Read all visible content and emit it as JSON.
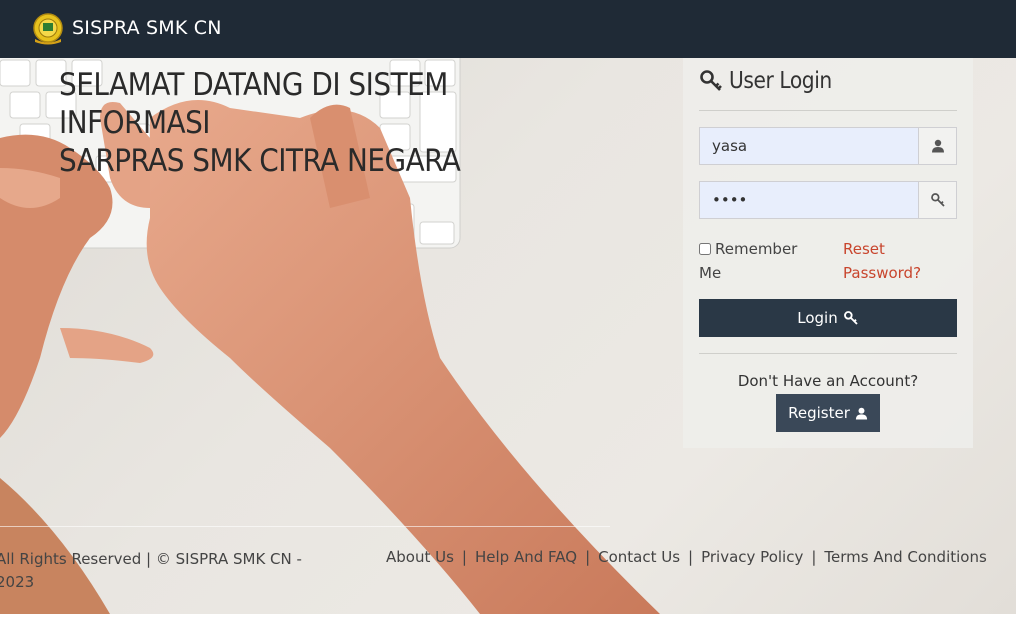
{
  "header": {
    "brand": "SISPRA SMK CN",
    "logo_icon": "school-emblem-icon"
  },
  "hero": {
    "welcome_line1": "SELAMAT DATANG DI SISTEM INFORMASI",
    "welcome_line2": "SARPRAS SMK CITRA NEGARA"
  },
  "login": {
    "title": "User Login",
    "title_icon": "key-icon",
    "username_value": "yasa",
    "username_icon": "user-icon",
    "password_value": "••••",
    "password_icon": "key-icon",
    "remember_label": "Remember Me",
    "reset_link": "Reset Password?",
    "login_button": "Login",
    "no_account_text": "Don't Have an Account?",
    "register_button": "Register"
  },
  "footer": {
    "copyright": "All Rights Reserved | © SISPRA SMK CN - 2023",
    "links": [
      "About Us",
      "Help And FAQ",
      "Contact Us",
      "Privacy Policy",
      "Terms And Conditions"
    ]
  },
  "colors": {
    "topbar": "#1f2a36",
    "button": "#2a3846",
    "link": "#c8452d",
    "input_bg": "#e8eefc"
  }
}
